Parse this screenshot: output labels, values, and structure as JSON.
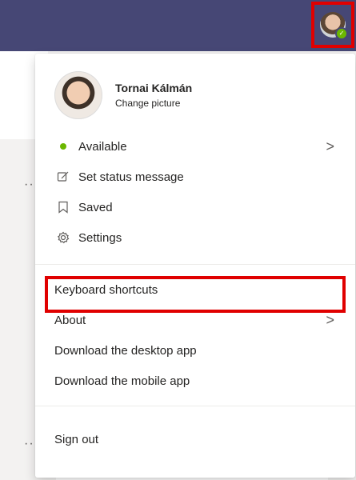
{
  "user": {
    "name": "Tornai Kálmán",
    "change_picture": "Change picture",
    "status": "Available"
  },
  "menu": {
    "set_status": "Set status message",
    "saved": "Saved",
    "settings": "Settings",
    "keyboard_shortcuts": "Keyboard shortcuts",
    "about": "About",
    "download_desktop": "Download the desktop app",
    "download_mobile": "Download the mobile app",
    "sign_out": "Sign out"
  },
  "background": {
    "dots1": "··",
    "dots2": "··"
  },
  "colors": {
    "topbar": "#464775",
    "presence": "#6bb700",
    "highlight": "#e00000"
  }
}
